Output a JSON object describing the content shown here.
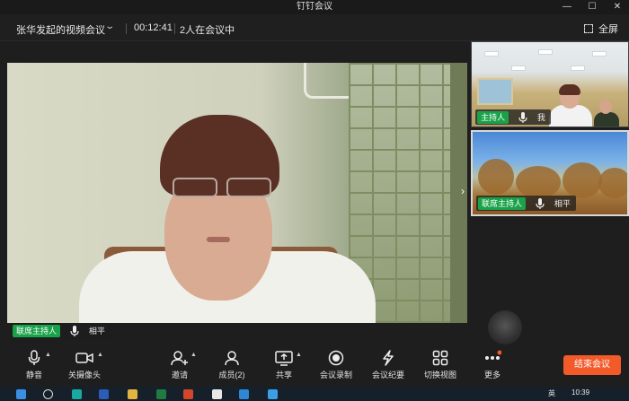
{
  "window": {
    "title": "钉钉会议",
    "controls": [
      "minimize",
      "maximize",
      "close"
    ]
  },
  "infobar": {
    "meeting_title": "张华发起的视频会议",
    "timer": "00:12:41",
    "participants_status": "2人在会议中",
    "fullscreen_label": "全屏"
  },
  "main_video": {
    "role": "联席主持人",
    "name": "相平"
  },
  "thumbnails": [
    {
      "role": "主持人",
      "name": "我"
    },
    {
      "role": "联席主持人",
      "name": "相平"
    }
  ],
  "toolbar": {
    "mute": "静音",
    "camera": "关摄像头",
    "invite": "邀请",
    "members": "成员(2)",
    "share": "共享",
    "record": "会议录制",
    "minutes": "会议纪要",
    "switch_view": "切换视图",
    "more": "更多",
    "end": "结束会议"
  },
  "taskbar": {
    "ime": "英",
    "clock": "10:39"
  },
  "colors": {
    "accent_green": "#1aa24a",
    "end_button": "#f25a2a",
    "background": "#1e1e1e"
  }
}
